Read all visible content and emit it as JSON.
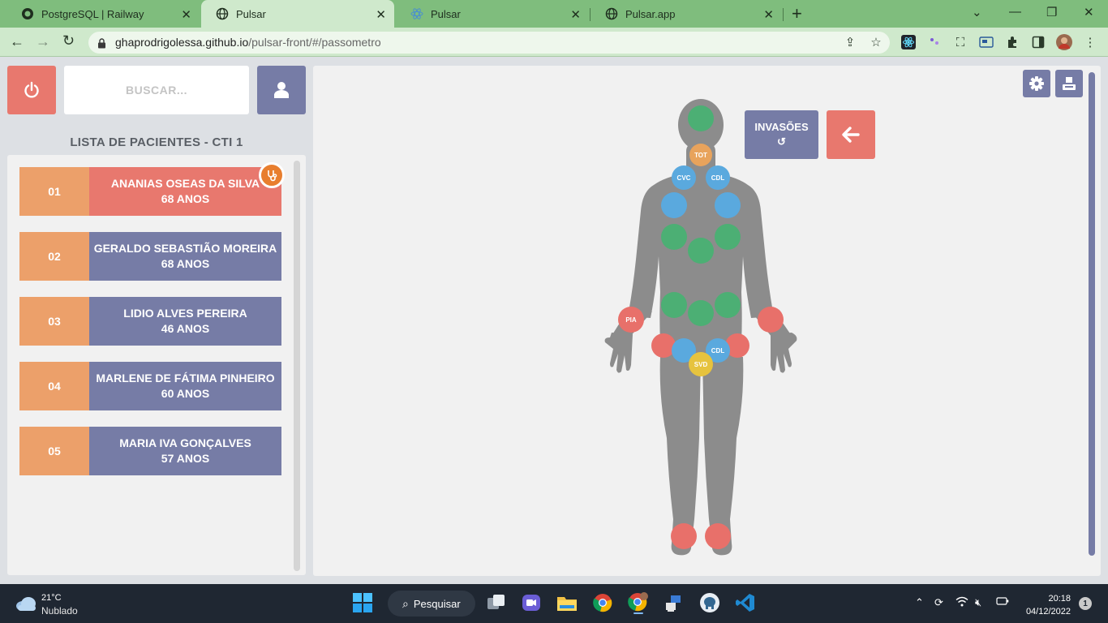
{
  "browser": {
    "tabs": [
      {
        "title": "PostgreSQL | Railway",
        "icon": "railway-icon"
      },
      {
        "title": "Pulsar",
        "icon": "globe-icon"
      },
      {
        "title": "Pulsar",
        "icon": "react-icon"
      },
      {
        "title": "Pulsar.app",
        "icon": "globe-icon"
      }
    ],
    "active_tab": 1,
    "url_host": "ghaprodrigolessa.github.io",
    "url_path": "/pulsar-front/#/passometro"
  },
  "header": {
    "search_placeholder": "BUSCAR...",
    "power_icon": "power-icon",
    "user_icon": "user-icon"
  },
  "patient_list": {
    "title": "LISTA DE PACIENTES - CTI 1",
    "patients": [
      {
        "num": "01",
        "name": "ANANIAS OSEAS DA SILVA",
        "age": "68 ANOS",
        "selected": true
      },
      {
        "num": "02",
        "name": "GERALDO SEBASTIÃO MOREIRA",
        "age": "68 ANOS",
        "selected": false
      },
      {
        "num": "03",
        "name": "LIDIO ALVES PEREIRA",
        "age": "46 ANOS",
        "selected": false
      },
      {
        "num": "04",
        "name": "MARLENE DE FÁTIMA PINHEIRO",
        "age": "60 ANOS",
        "selected": false
      },
      {
        "num": "05",
        "name": "MARIA IVA GONÇALVES",
        "age": "57 ANOS",
        "selected": false
      }
    ]
  },
  "body_map": {
    "invasoes_label": "INVASÕES",
    "invasoes_icon": "refresh-icon",
    "back_icon": "arrow-left-icon",
    "settings_icon": "gear-icon",
    "print_icon": "print-icon",
    "spots": [
      {
        "label": "TOT",
        "color": "#e8a35c"
      },
      {
        "label": "CVC",
        "color": "#5aa9de"
      },
      {
        "label": "CDL",
        "color": "#5aa9de"
      },
      {
        "label": "PIA",
        "color": "#e8706a"
      },
      {
        "label": "CDL",
        "color": "#5aa9de"
      },
      {
        "label": "SVD",
        "color": "#e6c33e"
      }
    ],
    "colors": {
      "green": "#4caf74",
      "blue": "#5aa9de",
      "red": "#e8706a",
      "orange": "#e8a35c",
      "yellow": "#e6c33e"
    }
  },
  "taskbar": {
    "temperature": "21°C",
    "weather": "Nublado",
    "search_label": "Pesquisar",
    "time": "20:18",
    "date": "04/12/2022",
    "notifications": "1"
  }
}
